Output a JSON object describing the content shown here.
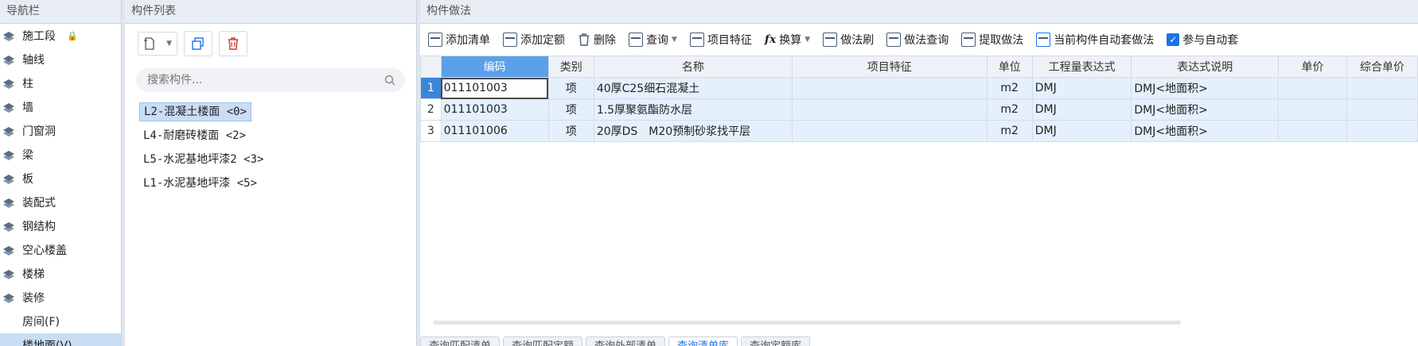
{
  "nav": {
    "title": "导航栏",
    "items": [
      {
        "label": "施工段",
        "icon": "stage-icon",
        "lock": true
      },
      {
        "label": "轴线",
        "icon": "grid-axis-icon"
      },
      {
        "label": "柱",
        "icon": "column-icon"
      },
      {
        "label": "墙",
        "icon": "wall-icon"
      },
      {
        "label": "门窗洞",
        "icon": "door-window-icon"
      },
      {
        "label": "梁",
        "icon": "beam-icon"
      },
      {
        "label": "板",
        "icon": "slab-icon"
      },
      {
        "label": "装配式",
        "icon": "prefab-icon"
      },
      {
        "label": "钢结构",
        "icon": "steel-icon"
      },
      {
        "label": "空心楼盖",
        "icon": "hollow-floor-icon"
      },
      {
        "label": "楼梯",
        "icon": "stair-icon"
      },
      {
        "label": "装修",
        "icon": "decoration-icon"
      },
      {
        "label": "房间(F)",
        "icon": ""
      },
      {
        "label": "楼地面(V)",
        "icon": "",
        "active": true
      }
    ]
  },
  "components": {
    "title": "构件列表",
    "search_placeholder": "搜索构件...",
    "items": [
      {
        "label": "L2-混凝土楼面 <0>",
        "selected": true
      },
      {
        "label": "L4-耐磨砖楼面 <2>"
      },
      {
        "label": "L5-水泥基地坪漆2 <3>"
      },
      {
        "label": "L1-水泥基地坪漆 <5>"
      }
    ]
  },
  "method": {
    "title": "构件做法",
    "toolbar": {
      "add_list": "添加清单",
      "add_quota": "添加定额",
      "delete": "删除",
      "query": "查询",
      "item_feature": "项目特征",
      "fx": "fx",
      "convert": "换算",
      "method_brush": "做法刷",
      "method_query": "做法查询",
      "extract_method": "提取做法",
      "auto_apply": "当前构件自动套做法",
      "join_auto": "参与自动套"
    },
    "columns": [
      "编码",
      "类别",
      "名称",
      "项目特征",
      "单位",
      "工程量表达式",
      "表达式说明",
      "单价",
      "综合单价"
    ],
    "rows": [
      {
        "no": "1",
        "code": "011101003",
        "type": "项",
        "name": "40厚C25细石混凝土",
        "feature": "",
        "unit": "m2",
        "expr": "DMJ",
        "desc": "DMJ<地面积>",
        "price": "",
        "total": ""
      },
      {
        "no": "2",
        "code": "011101003",
        "type": "项",
        "name": "1.5厚聚氨酯防水层",
        "feature": "",
        "unit": "m2",
        "expr": "DMJ",
        "desc": "DMJ<地面积>",
        "price": "",
        "total": ""
      },
      {
        "no": "3",
        "code": "011101006",
        "type": "项",
        "name": "20厚DS　M20预制砂浆找平层",
        "feature": "",
        "unit": "m2",
        "expr": "DMJ",
        "desc": "DMJ<地面积>",
        "price": "",
        "total": ""
      }
    ],
    "bottom_tabs": [
      "查询匹配清单",
      "查询匹配定额",
      "查询外部清单",
      "查询清单库",
      "查询定额库"
    ],
    "active_tab": 3
  }
}
